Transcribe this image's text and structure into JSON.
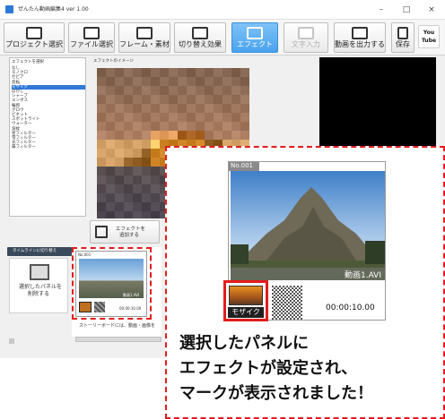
{
  "window": {
    "title": "ぜんたん動画編集4 ver 1.00",
    "controls": [
      "–",
      "□",
      "×"
    ]
  },
  "toolbar": {
    "buttons": [
      {
        "label": "プロジェクト選択",
        "icon": "project-icon"
      },
      {
        "label": "ファイル選択",
        "icon": "file-icon"
      },
      {
        "label": "フレーム・素材",
        "icon": "frame-icon"
      },
      {
        "label": "切り替え効果",
        "icon": "transition-icon"
      },
      {
        "label": "エフェクト",
        "icon": "effect-icon"
      },
      {
        "label": "文字入力",
        "icon": "text-input-icon"
      },
      {
        "label": "動画を出力する",
        "icon": "export-icon"
      },
      {
        "label": "保存",
        "icon": "save-icon"
      }
    ],
    "youtube_label": "You Tube"
  },
  "effects_panel": {
    "header": "エフェクトを選択",
    "items": [
      "なし",
      "モノクロ",
      "セピア",
      "反転",
      "モザイク",
      "ぼかし",
      "シャープ",
      "エンボス",
      "輪郭",
      "グロウ",
      "ビネット",
      "スポットライト",
      "ウォーター",
      "波紋",
      "星フィルター",
      "雪フィルター",
      "光フィルター",
      "霧フィルター"
    ],
    "selected_index": 4
  },
  "preview": {
    "header": "エフェクトのイメージ"
  },
  "add_effect_button": {
    "line1": "エフェクトを",
    "line2": "追加する"
  },
  "timeline": {
    "tab_label": "タイムラインに切り替え",
    "delete_line1": "選択したパネルを",
    "delete_line2": "削除する",
    "panel_number": "No.001",
    "panel_caption": "動画1.AVI",
    "panel_time": "00:00:10.00",
    "storyboard_hint": "ストーリーボードには、動画・画像を"
  },
  "callout": {
    "panel_number": "No.001",
    "panel_caption": "動画1.AVI",
    "effect_badge": "モザイク",
    "time": "00:00:10.00",
    "message_line1": "選択したパネルに",
    "message_line2": "エフェクトが設定され、",
    "message_line3": "マークが表示されました！"
  },
  "colors": {
    "accent": "#4aa3ee",
    "selection": "#3078d8",
    "highlight_red": "#e31c1c"
  }
}
